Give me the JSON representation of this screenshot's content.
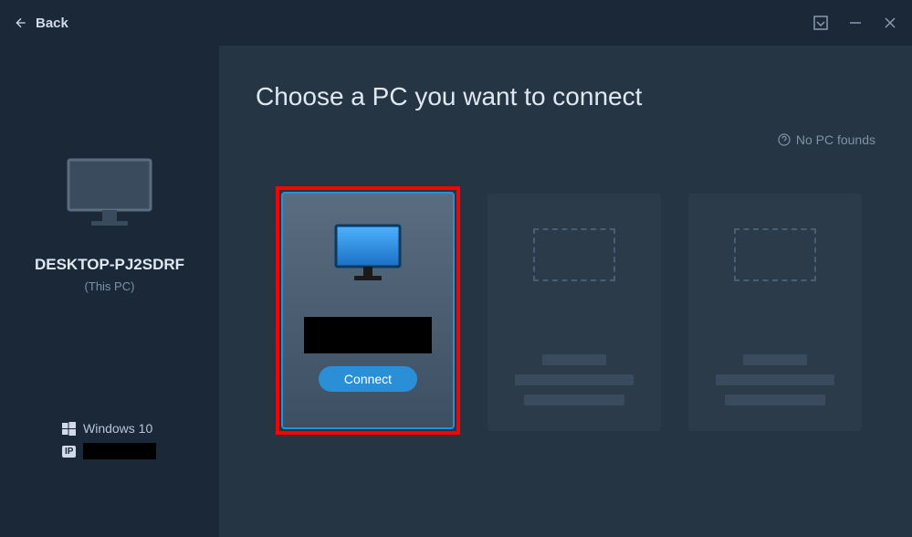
{
  "titlebar": {
    "back_label": "Back"
  },
  "sidebar": {
    "pc_name": "DESKTOP-PJ2SDRF",
    "pc_label": "(This PC)",
    "os_label": "Windows 10",
    "ip_badge": "IP",
    "ip_value": ""
  },
  "main": {
    "title": "Choose a PC you want to connect",
    "help_link": "No PC founds",
    "pcs": [
      {
        "name_redacted": true,
        "connect_label": "Connect",
        "selected": true
      }
    ]
  }
}
